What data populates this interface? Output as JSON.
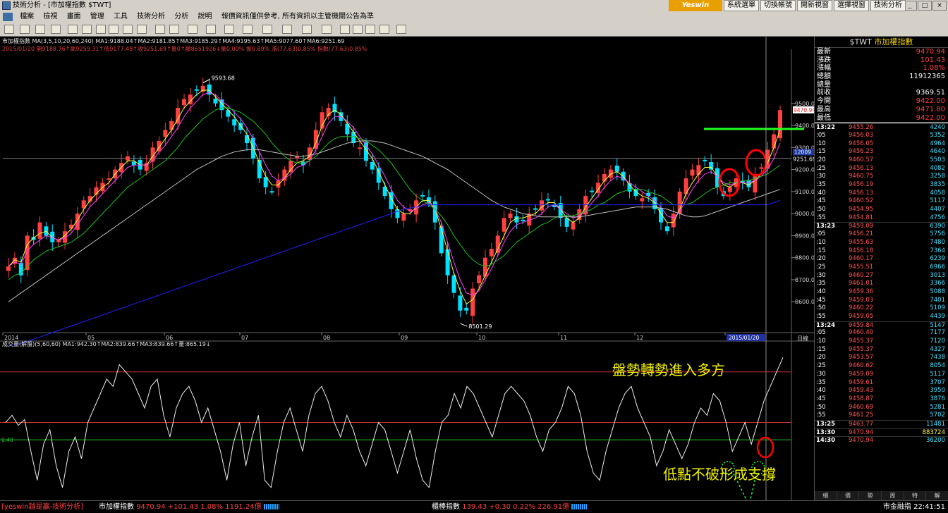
{
  "window": {
    "title": "技術分析 - [市加權指數 $TWT]",
    "controls": [
      "_",
      "□",
      "×"
    ]
  },
  "menu": [
    "檔案",
    "檢視",
    "畫面",
    "管理",
    "工具",
    "技術分析",
    "分析",
    "說明",
    "報價資訊僅供參考, 所有資訊以主管機關公告為準"
  ],
  "top_buttons": {
    "logo": "Yeswin",
    "items": [
      "系統選單",
      "切換帳號",
      "開新視窗",
      "選擇視窗",
      "技術分析"
    ]
  },
  "indicator_header": {
    "line1": "市加權指數  MA(3,5,10,20,60,240)  MA1:9188.04↑MA2:9181.85↑MA3:9185.29↑MA4:9195.63↑MA5:9077.60↑MA6:9251.69",
    "line2": "2015/01/20  開9188.76↑高9259.31↑低9177.48↑收9251.69↑量0↑額8651926↓量0.00% 振0.89% 漲(77.63)0.85% 指數(77.63)0.85%"
  },
  "volume_header": "成交量(解盤)(5,60,60)  MA1:942.30↑MA2:839.66↑MA3:839.66↑量:865.19↓",
  "chart_data": {
    "type": "candlestick",
    "symbol": "$TWT",
    "title": "市加權指數",
    "x_tick_labels": [
      "2014",
      "05",
      "06",
      "07",
      "08",
      "09",
      "10",
      "11",
      "12",
      "2015/01/20"
    ],
    "y_tick_labels": [
      "9500.0",
      "9400.0",
      "9300.0",
      "9200.0",
      "9100.0",
      "9000.0",
      "8900.0",
      "8800.0",
      "8700.0",
      "8600.0"
    ],
    "ylim": [
      8460,
      9720
    ],
    "annotations": {
      "high": "9593.68",
      "low": "8501.29",
      "last_price": "9470.94",
      "ma_price": "9251.69",
      "ma_price_box": "12009"
    },
    "close_path": [
      8760,
      8800,
      8720,
      8900,
      8880,
      8960,
      8900,
      8870,
      8880,
      8920,
      8950,
      9000,
      9060,
      9080,
      9120,
      9140,
      9160,
      9200,
      9230,
      9260,
      9220,
      9200,
      9230,
      9300,
      9330,
      9380,
      9420,
      9480,
      9520,
      9540,
      9560,
      9580,
      9540,
      9500,
      9470,
      9440,
      9400,
      9380,
      9320,
      9250,
      9160,
      9120,
      9100,
      9150,
      9200,
      9240,
      9260,
      9220,
      9300,
      9380,
      9460,
      9480,
      9460,
      9420,
      9360,
      9320,
      9300,
      9240,
      9200,
      9140,
      9080,
      9020,
      8980,
      9000,
      9020,
      9060,
      9080,
      9050,
      8960,
      8820,
      8720,
      8640,
      8560,
      8560,
      8660,
      8720,
      8800,
      8840,
      8900,
      8980,
      9000,
      8960,
      8970,
      9000,
      9020,
      9060,
      9060,
      9030,
      8980,
      8940,
      8960,
      9020,
      9080,
      9100,
      9140,
      9180,
      9200,
      9190,
      9150,
      9100,
      9080,
      9070,
      9080,
      9020,
      8960,
      8920,
      9000,
      9100,
      9160,
      9200,
      9220,
      9240,
      9200,
      9120,
      9080,
      9120,
      9160,
      9140,
      9120,
      9180,
      9210,
      9290,
      9360,
      9470
    ],
    "ma_lines": [
      {
        "name": "MA1",
        "color": "#ffff40",
        "values": [
          8760,
          8790,
          8780,
          8860,
          8890,
          8910,
          8920,
          8890,
          8880,
          8900,
          8930,
          8970,
          9020,
          9060,
          9090,
          9120,
          9140,
          9180,
          9210,
          9240,
          9240,
          9220,
          9220,
          9260,
          9300,
          9340,
          9380,
          9430,
          9480,
          9510,
          9540,
          9560,
          9560,
          9530,
          9500,
          9470,
          9440,
          9400,
          9360,
          9300,
          9230,
          9170,
          9130,
          9130,
          9160,
          9200,
          9230,
          9240,
          9260,
          9320,
          9400,
          9450,
          9470,
          9450,
          9410,
          9370,
          9330,
          9290,
          9250,
          9190,
          9130,
          9070,
          9020,
          9000,
          9000,
          9030,
          9060,
          9060,
          9020,
          8930,
          8830,
          8730,
          8650,
          8590,
          8610,
          8660,
          8720,
          8780,
          8840,
          8900,
          8960,
          8980,
          8980,
          8990,
          9000,
          9030,
          9050,
          9050,
          9020,
          8980,
          8960,
          8980,
          9030,
          9070,
          9110,
          9150,
          9180,
          9190,
          9170,
          9130,
          9100,
          9080,
          9070,
          9050,
          9000,
          8960,
          8960,
          9020,
          9090,
          9140,
          9180,
          9210,
          9210,
          9170,
          9130,
          9120,
          9140,
          9140,
          9130,
          9150,
          9180,
          9230,
          9300,
          9380
        ]
      },
      {
        "name": "MA2",
        "color": "#ff40ff",
        "values": [
          8760,
          8780,
          8770,
          8830,
          8860,
          8880,
          8900,
          8890,
          8880,
          8890,
          8910,
          8950,
          8990,
          9030,
          9060,
          9090,
          9120,
          9150,
          9180,
          9210,
          9220,
          9220,
          9220,
          9240,
          9280,
          9310,
          9350,
          9390,
          9440,
          9480,
          9510,
          9540,
          9550,
          9540,
          9510,
          9490,
          9460,
          9430,
          9390,
          9340,
          9280,
          9220,
          9170,
          9150,
          9160,
          9180,
          9210,
          9220,
          9240,
          9290,
          9350,
          9410,
          9440,
          9440,
          9420,
          9390,
          9350,
          9310,
          9270,
          9220,
          9170,
          9110,
          9060,
          9030,
          9010,
          9020,
          9040,
          9050,
          9020,
          8960,
          8870,
          8780,
          8700,
          8640,
          8630,
          8650,
          8700,
          8750,
          8810,
          8870,
          8920,
          8950,
          8960,
          8970,
          8980,
          9000,
          9030,
          9040,
          9020,
          9000,
          8980,
          8990,
          9010,
          9050,
          9080,
          9120,
          9150,
          9170,
          9160,
          9140,
          9120,
          9100,
          9080,
          9060,
          9030,
          8990,
          8980,
          9010,
          9060,
          9110,
          9150,
          9180,
          9190,
          9170,
          9140,
          9130,
          9140,
          9140,
          9140,
          9150,
          9170,
          9200,
          9250,
          9320
        ]
      },
      {
        "name": "MA4",
        "color": "#20c020",
        "values": [
          8700,
          8720,
          8730,
          8760,
          8790,
          8810,
          8830,
          8840,
          8850,
          8860,
          8870,
          8890,
          8910,
          8940,
          8970,
          9000,
          9030,
          9060,
          9090,
          9120,
          9140,
          9160,
          9180,
          9200,
          9220,
          9240,
          9270,
          9300,
          9340,
          9370,
          9400,
          9430,
          9450,
          9470,
          9480,
          9480,
          9470,
          9460,
          9440,
          9420,
          9390,
          9360,
          9320,
          9290,
          9260,
          9240,
          9230,
          9230,
          9240,
          9260,
          9290,
          9320,
          9340,
          9350,
          9350,
          9350,
          9340,
          9330,
          9310,
          9290,
          9260,
          9230,
          9190,
          9150,
          9110,
          9080,
          9060,
          9040,
          9020,
          8990,
          8950,
          8900,
          8860,
          8820,
          8790,
          8770,
          8760,
          8770,
          8790,
          8810,
          8840,
          8870,
          8890,
          8910,
          8930,
          8950,
          8960,
          8980,
          8990,
          8990,
          8990,
          9000,
          9010,
          9020,
          9040,
          9050,
          9070,
          9090,
          9100,
          9110,
          9110,
          9110,
          9100,
          9090,
          9080,
          9060,
          9040,
          9040,
          9040,
          9050,
          9070,
          9090,
          9110,
          9120,
          9130,
          9140,
          9140,
          9150,
          9150,
          9160,
          9170,
          9180,
          9200,
          9220
        ]
      },
      {
        "name": "MA5",
        "color": "#c0c0c0",
        "values": [
          8600,
          8620,
          8640,
          8660,
          8680,
          8700,
          8720,
          8740,
          8760,
          8780,
          8800,
          8820,
          8840,
          8860,
          8880,
          8900,
          8920,
          8940,
          8960,
          8980,
          9000,
          9020,
          9040,
          9060,
          9080,
          9100,
          9120,
          9140,
          9160,
          9180,
          9200,
          9215,
          9230,
          9245,
          9260,
          9270,
          9280,
          9285,
          9290,
          9290,
          9290,
          9285,
          9280,
          9275,
          9270,
          9265,
          9260,
          9260,
          9265,
          9270,
          9280,
          9290,
          9300,
          9310,
          9320,
          9325,
          9330,
          9330,
          9330,
          9325,
          9320,
          9310,
          9300,
          9290,
          9280,
          9270,
          9260,
          9245,
          9230,
          9215,
          9200,
          9180,
          9160,
          9140,
          9120,
          9100,
          9080,
          9060,
          9045,
          9030,
          9020,
          9010,
          9000,
          8995,
          8990,
          8985,
          8985,
          8985,
          8985,
          8985,
          8985,
          8985,
          8990,
          8995,
          9000,
          9005,
          9010,
          9015,
          9020,
          9025,
          9030,
          9030,
          9030,
          9030,
          9025,
          9020,
          9010,
          9000,
          8990,
          8985,
          8985,
          8990,
          9000,
          9010,
          9020,
          9030,
          9040,
          9050,
          9060,
          9070,
          9080,
          9090,
          9100,
          9110
        ]
      },
      {
        "name": "MA6",
        "color": "#2020ff",
        "values": [
          8400,
          8405,
          8410,
          8420,
          8430,
          8440,
          8450,
          8460,
          8470,
          8480,
          8490,
          8500,
          8510,
          8520,
          8530,
          8540,
          8550,
          8560,
          8570,
          8580,
          8590,
          8600,
          8610,
          8620,
          8630,
          8640,
          8650,
          8660,
          8670,
          8680,
          8690,
          8700,
          8710,
          8720,
          8730,
          8740,
          8750,
          8760,
          8770,
          8780,
          8790,
          8800,
          8810,
          8820,
          8830,
          8840,
          8850,
          8860,
          8870,
          8880,
          8890,
          8900,
          8910,
          8920,
          8930,
          8940,
          8950,
          8960,
          8970,
          8980,
          8990,
          9000,
          9010,
          9020,
          9025,
          9030,
          9035,
          9040,
          9040,
          9040,
          9040,
          9040,
          9040,
          9040,
          9040,
          9040,
          9040,
          9040,
          9040,
          9040,
          9040,
          9040,
          9040,
          9040,
          9040,
          9040,
          9040,
          9040,
          9040,
          9040,
          9040,
          9040,
          9040,
          9040,
          9040,
          9040,
          9040,
          9040,
          9040,
          9040,
          9040,
          9040,
          9040,
          9040,
          9040,
          9040,
          9040,
          9040,
          9040,
          9040,
          9040,
          9040,
          9040,
          9040,
          9040,
          9040,
          9040,
          9040,
          9040,
          9040,
          9040,
          9040,
          9050,
          9060
        ]
      }
    ],
    "volume_oscillator": [
      0.5,
      0.55,
      0.48,
      0.52,
      0.3,
      0.1,
      0.35,
      0.45,
      0.2,
      0.05,
      0.3,
      0.4,
      0.25,
      0.5,
      0.6,
      0.7,
      0.8,
      0.75,
      0.9,
      0.85,
      0.8,
      0.7,
      0.6,
      0.75,
      0.8,
      0.55,
      0.4,
      0.6,
      0.7,
      0.75,
      0.65,
      0.5,
      0.6,
      0.45,
      0.3,
      0.1,
      0.35,
      0.5,
      0.2,
      0.4,
      0.55,
      0.1,
      0.05,
      0.3,
      0.5,
      0.6,
      0.45,
      0.3,
      0.55,
      0.7,
      0.75,
      0.65,
      0.5,
      0.4,
      0.55,
      0.45,
      0.3,
      0.2,
      0.35,
      0.5,
      0.45,
      0.3,
      0.15,
      0.3,
      0.45,
      0.25,
      0.1,
      0.05,
      0.3,
      0.5,
      0.55,
      0.7,
      0.6,
      0.75,
      0.7,
      0.6,
      0.5,
      0.4,
      0.55,
      0.7,
      0.75,
      0.7,
      0.65,
      0.55,
      0.4,
      0.3,
      0.45,
      0.5,
      0.6,
      0.75,
      0.7,
      0.55,
      0.3,
      0.15,
      0.1,
      0.3,
      0.45,
      0.6,
      0.7,
      0.75,
      0.6,
      0.5,
      0.4,
      0.2,
      0.3,
      0.45,
      0.35,
      0.25,
      0.35,
      0.5,
      0.6,
      0.55,
      0.7,
      0.65,
      0.5,
      0.3,
      0.4,
      0.5,
      0.35,
      0.5,
      0.65,
      0.75,
      0.85,
      0.95
    ],
    "volume_level_labels": {
      "reference": "0.40"
    },
    "ohlc_axis_hint": "8501.29"
  },
  "annotations_text": {
    "trend": "盤勢轉勢進入多方",
    "support": "低點不破形成支撐"
  },
  "axis_labels": {
    "date_label": "日線"
  },
  "quote_panel": {
    "title_symbol": "$TWT",
    "title_name": "市加權指數",
    "rows": [
      {
        "k": "最新",
        "v": "9470.94",
        "c": "#ff4040"
      },
      {
        "k": "漲跌",
        "v": "101.43",
        "c": "#ff4040"
      },
      {
        "k": "漲幅",
        "v": "1.08%",
        "c": "#ff4040"
      },
      {
        "k": "總額",
        "v": "11912365",
        "c": "#ffffff"
      },
      {
        "k": "總量",
        "v": "",
        "c": "#ffffff"
      },
      {
        "k": "前收",
        "v": "9369.51",
        "c": "#ffffff"
      },
      {
        "k": "今開",
        "v": "9422.00",
        "c": "#ff4040"
      },
      {
        "k": "最高",
        "v": "9471.80",
        "c": "#ff4040"
      },
      {
        "k": "最低",
        "v": "9422.00",
        "c": "#ff4040"
      }
    ],
    "ticks": [
      {
        "t": "13:22",
        "p": "9455.26",
        "q": "4240",
        "h": true
      },
      {
        "t": ":05",
        "p": "9456.03",
        "q": "5352"
      },
      {
        "t": ":10",
        "p": "9456.05",
        "q": "4964"
      },
      {
        "t": ":15",
        "p": "9456.23",
        "q": "4640"
      },
      {
        "t": ":20",
        "p": "9460.57",
        "q": "5503"
      },
      {
        "t": ":25",
        "p": "9456.13",
        "q": "4082"
      },
      {
        "t": ":30",
        "p": "9460.75",
        "q": "3258"
      },
      {
        "t": ":35",
        "p": "9456.19",
        "q": "3835"
      },
      {
        "t": ":40",
        "p": "9456.13",
        "q": "4058"
      },
      {
        "t": ":45",
        "p": "9460.52",
        "q": "5117"
      },
      {
        "t": ":50",
        "p": "9454.95",
        "q": "4407"
      },
      {
        "t": ":55",
        "p": "9454.81",
        "q": "4756"
      },
      {
        "t": "13:23",
        "p": "9459.09",
        "q": "6390",
        "h": true
      },
      {
        "t": ":05",
        "p": "9456.21",
        "q": "5756"
      },
      {
        "t": ":10",
        "p": "9455.63",
        "q": "7480"
      },
      {
        "t": ":15",
        "p": "9456.18",
        "q": "7364"
      },
      {
        "t": ":20",
        "p": "9460.17",
        "q": "6239"
      },
      {
        "t": ":25",
        "p": "9455.51",
        "q": "6966"
      },
      {
        "t": ":30",
        "p": "9460.27",
        "q": "3013"
      },
      {
        "t": ":35",
        "p": "9461.01",
        "q": "3366"
      },
      {
        "t": ":40",
        "p": "9459.36",
        "q": "5088"
      },
      {
        "t": ":45",
        "p": "9459.03",
        "q": "7401"
      },
      {
        "t": ":50",
        "p": "9460.22",
        "q": "5109"
      },
      {
        "t": ":55",
        "p": "9459.05",
        "q": "4439"
      },
      {
        "t": "13:24",
        "p": "9459.84",
        "q": "5147",
        "h": true
      },
      {
        "t": ":05",
        "p": "9460.40",
        "q": "7177"
      },
      {
        "t": ":10",
        "p": "9455.37",
        "q": "7120"
      },
      {
        "t": ":15",
        "p": "9455.37",
        "q": "4327"
      },
      {
        "t": ":20",
        "p": "9453.57",
        "q": "7438"
      },
      {
        "t": ":25",
        "p": "9460.62",
        "q": "8054"
      },
      {
        "t": ":30",
        "p": "9459.09",
        "q": "5117"
      },
      {
        "t": ":35",
        "p": "9459.61",
        "q": "3707"
      },
      {
        "t": ":40",
        "p": "9459.43",
        "q": "3950"
      },
      {
        "t": ":45",
        "p": "9458.87",
        "q": "3876"
      },
      {
        "t": ":50",
        "p": "9460.69",
        "q": "5281"
      },
      {
        "t": ":55",
        "p": "9461.25",
        "q": "5702"
      },
      {
        "t": "13:25",
        "p": "9463.77",
        "q": "11481",
        "h": true
      },
      {
        "t": "13:30",
        "p": "9470.94",
        "q": "883724",
        "h": true,
        "y": true
      },
      {
        "t": "14:30",
        "p": "9470.94",
        "q": "36200",
        "h": true
      }
    ],
    "tabs": [
      "細",
      "價",
      "勢",
      "周",
      "特",
      "解"
    ]
  },
  "status_bar": {
    "app": "[yeswin越是贏-技術分析]",
    "idx1_name": "市加權指數",
    "idx1_vals": "9470.94 +101.43 1.08% 1191.24億",
    "idx2_name": "櫃檯指數",
    "idx2_vals": "139.43 +0.30 0.22% 226.91億",
    "right": "市金融指 22:41:51"
  },
  "colors": {
    "up": "#ff4040",
    "down": "#00e0ff",
    "accent": "#f0f000",
    "grid": "#3a3a3a",
    "support_line": "#20ff20",
    "circle": "#ff0000"
  }
}
